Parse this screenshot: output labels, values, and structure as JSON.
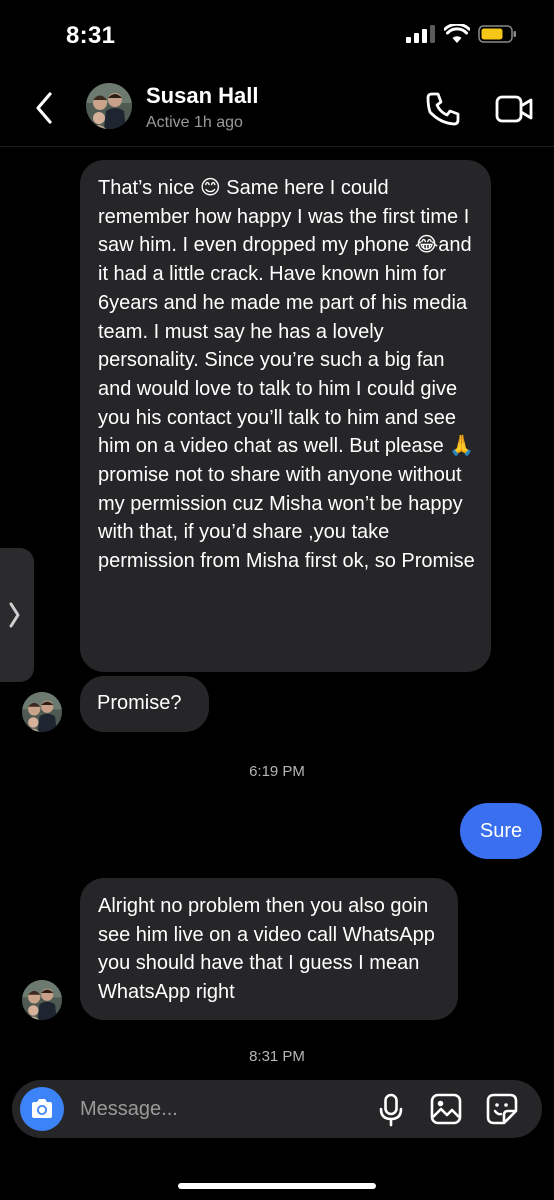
{
  "status_bar": {
    "time": "8:31"
  },
  "header": {
    "contact_name": "Susan Hall",
    "contact_status": "Active 1h ago"
  },
  "messages": [
    {
      "direction": "received",
      "text": "That’s nice 😊 Same here I could remember how happy I was the first time I saw him. I even dropped my phone 😂and it had a little crack. Have known him for 6years and he made me part of his media team. I must say he has a lovely personality. Since you’re such a big fan and would love to talk to him I could give you his contact you’ll talk to him and see him on a video chat as well. But please 🙏 promise not to share with anyone without my permission cuz Misha won’t be happy with that, if you’d share ,you take permission from Misha first ok, so Promise"
    },
    {
      "direction": "received",
      "text": "Promise?"
    },
    {
      "direction": "sent",
      "text": "Sure"
    },
    {
      "direction": "received",
      "text": "Alright no problem then you also goin see him live on a video call WhatsApp you should have that I guess I mean WhatsApp right"
    }
  ],
  "timestamps": [
    "6:19 PM",
    "8:31 PM"
  ],
  "composer": {
    "placeholder": "Message..."
  },
  "icons": {
    "back": "chevron-left-icon",
    "call": "phone-icon",
    "video": "video-camera-icon",
    "side_tab": "chevron-right-icon",
    "camera": "camera-icon",
    "mic": "microphone-icon",
    "gallery": "image-icon",
    "sticker": "sticker-icon"
  },
  "colors": {
    "background": "#000000",
    "received_bubble": "#262628",
    "sent_bubble": "#3a6ff0",
    "camera_button": "#3b83f6",
    "battery": "#f5c518"
  }
}
